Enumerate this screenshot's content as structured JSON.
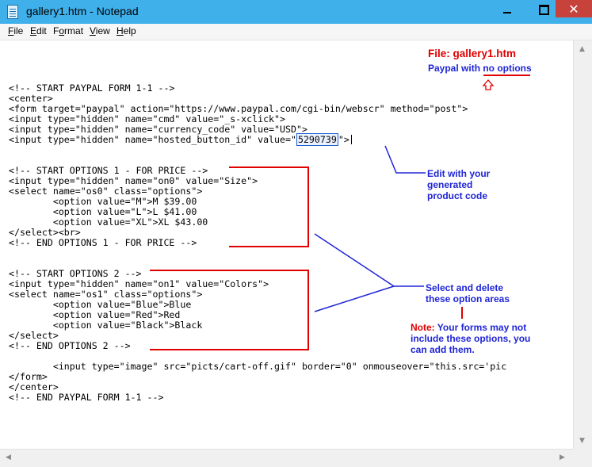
{
  "window": {
    "title": "gallery1.htm - Notepad",
    "close_glyph": "✕"
  },
  "menu": {
    "file": {
      "u": "F",
      "rest": "ile"
    },
    "edit": {
      "u": "E",
      "rest": "dit"
    },
    "format": {
      "pre": "F",
      "u": "o",
      "rest": "rmat"
    },
    "view": {
      "u": "V",
      "rest": "iew"
    },
    "help": {
      "u": "H",
      "rest": "elp"
    }
  },
  "code": {
    "lines": [
      "<!-- START PAYPAL FORM 1-1 -->",
      "<center>",
      "<form target=\"paypal\" action=\"https://www.paypal.com/cgi-bin/webscr\" method=\"post\">",
      "<input type=\"hidden\" name=\"cmd\" value=\"_s-xclick\">",
      "<input type=\"hidden\" name=\"currency_code\" value=\"USD\">",
      "<!-- START OPTIONS 1 - FOR PRICE -->",
      "<input type=\"hidden\" name=\"on0\" value=\"Size\">",
      "<select name=\"os0\" class=\"options\">",
      "        <option value=\"M\">M $39.00",
      "        <option value=\"L\">L $41.00",
      "        <option value=\"XL\">XL $43.00",
      "</select><br>",
      "<!-- END OPTIONS 1 - FOR PRICE -->",
      "<!-- START OPTIONS 2 -->",
      "<input type=\"hidden\" name=\"on1\" value=\"Colors\">",
      "<select name=\"os1\" class=\"options\">",
      "        <option value=\"Blue\">Blue",
      "        <option value=\"Red\">Red",
      "        <option value=\"Black\">Black",
      "</select>",
      "<!-- END OPTIONS 2 -->",
      "        <input type=\"image\" src=\"picts/cart-off.gif\" border=\"0\" onmouseover=\"this.src='pic",
      "</form>",
      "</center>",
      "<!-- END PAYPAL FORM 1-1 -->"
    ],
    "hosted_prefix": "<input type=\"hidden\" name=\"hosted_button_id\" value=\"",
    "hosted_value": "5290739",
    "hosted_suffix": "\">"
  },
  "annotations": {
    "file_label": "File: gallery1.htm",
    "file_sub": "Paypal with no options",
    "edit_note_1": "Edit with your",
    "edit_note_2": "generated",
    "edit_note_3": "product code",
    "select_note_1": "Select and delete",
    "select_note_2": "these option areas",
    "note_prefix": "Note:",
    "note_1": " Your forms may not",
    "note_2": "include these options, you",
    "note_3": "can add them."
  },
  "colors": {
    "annotation_blue": "#1f25d6",
    "annotation_red": "#e00000",
    "titlebar": "#3fb0ea",
    "close_button": "#c7423a"
  }
}
